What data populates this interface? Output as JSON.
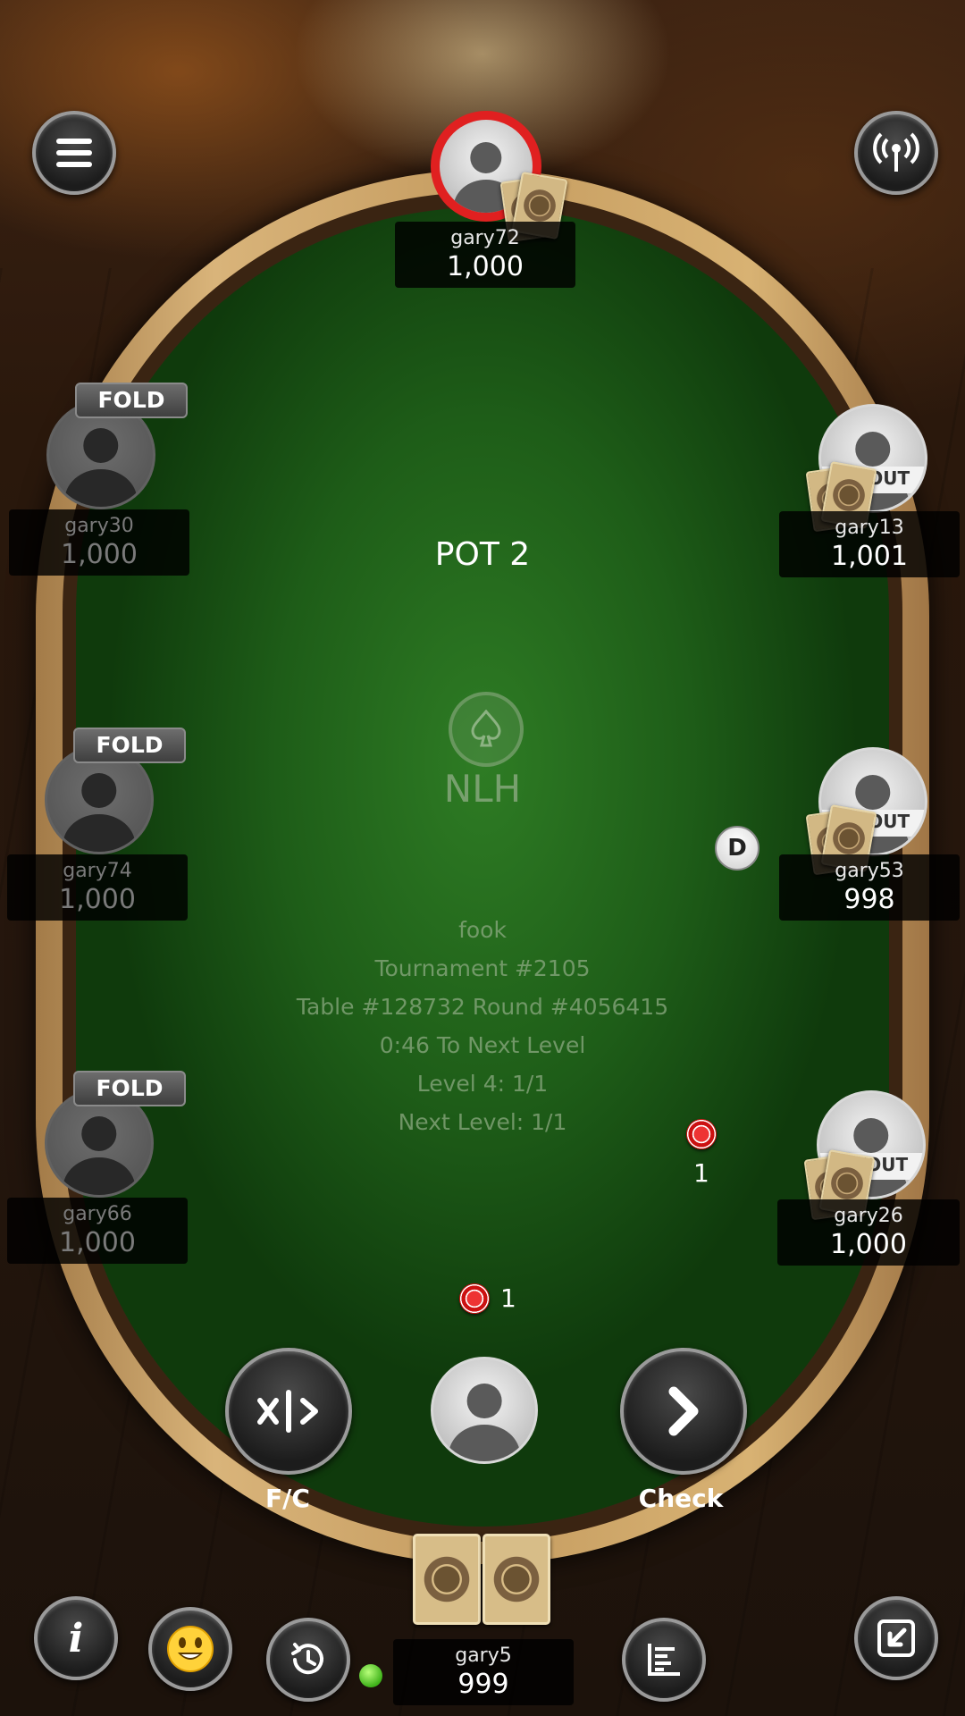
{
  "table": {
    "pot_label": "POT 2",
    "game_type": "NLH",
    "info_lines": [
      "fook",
      "Tournament #2105",
      "Table #128732 Round #4056415",
      "0:46 To Next Level",
      "Level 4: 1/1",
      "Next Level: 1/1"
    ],
    "dealer_button": "D"
  },
  "players": [
    {
      "seat": "top",
      "name": "gary72",
      "stack": "1,000",
      "status": "active-turn",
      "has_cards": true
    },
    {
      "seat": "left-1",
      "name": "gary30",
      "stack": "1,000",
      "status": "FOLD"
    },
    {
      "seat": "left-2",
      "name": "gary74",
      "stack": "1,000",
      "status": "FOLD"
    },
    {
      "seat": "left-3",
      "name": "gary66",
      "stack": "1,000",
      "status": "FOLD"
    },
    {
      "seat": "right-1",
      "name": "gary13",
      "stack": "1,001",
      "status": "SITOUT",
      "has_cards": true
    },
    {
      "seat": "right-2",
      "name": "gary53",
      "stack": "998",
      "status": "SITOUT",
      "has_cards": true
    },
    {
      "seat": "right-3",
      "name": "gary26",
      "stack": "1,000",
      "status": "SITOUT",
      "has_cards": true
    }
  ],
  "hero": {
    "name": "gary5",
    "stack": "999",
    "online": true
  },
  "bets": [
    {
      "owner": "gary26",
      "amount": "1"
    },
    {
      "owner": "gary5",
      "amount": "1"
    }
  ],
  "actions": {
    "fold_check_label": "F/C",
    "check_label": "Check"
  },
  "badges": {
    "fold": "FOLD",
    "sitout": "SITOUT"
  },
  "icons": [
    "menu-icon",
    "signal-icon",
    "info-icon",
    "emoji-icon",
    "history-icon",
    "stats-icon",
    "exit-icon"
  ],
  "colors": {
    "felt": "#1e5d18",
    "rail": "#c59c60",
    "turn_ring": "#e02020"
  }
}
